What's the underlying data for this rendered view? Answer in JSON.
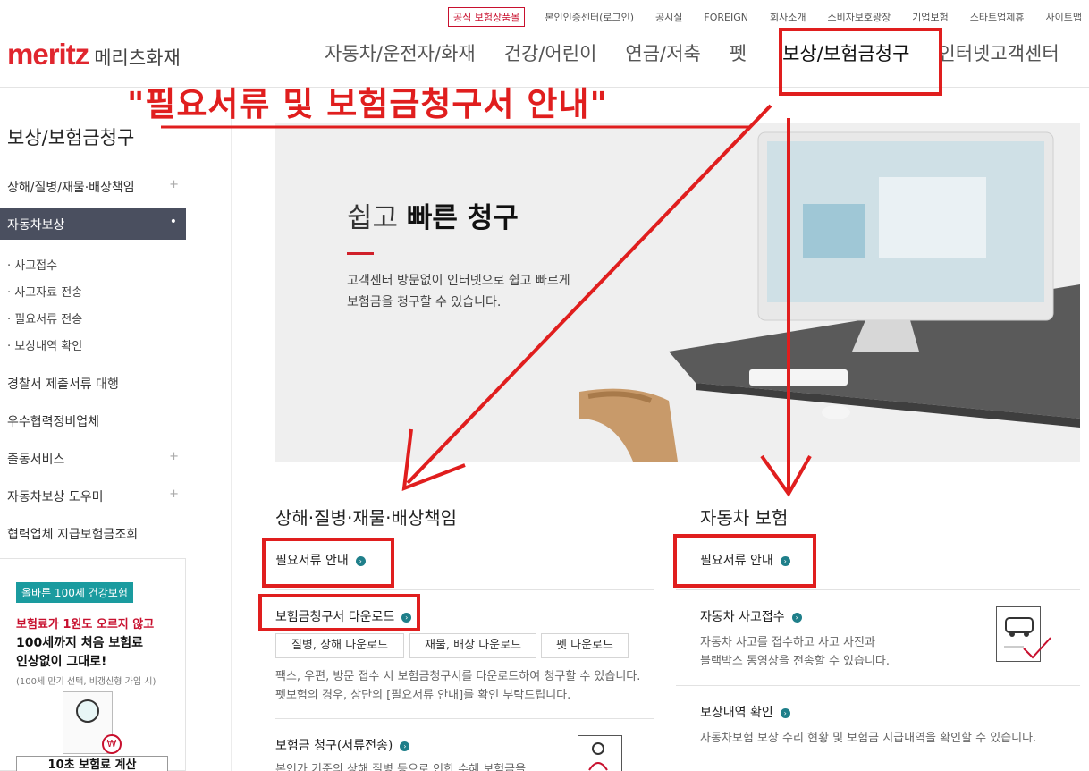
{
  "utility": {
    "official_shop": "공식 보험상품몰",
    "links": [
      "본인인증센터(로그인)",
      "공시실",
      "FOREIGN",
      "회사소개",
      "소비자보호광장",
      "기업보험",
      "스타트업제휴",
      "사이트맵"
    ]
  },
  "brand": {
    "logo_en": "meritz",
    "logo_ko": "메리츠화재",
    "color": "#e0262e"
  },
  "gnb": [
    "자동차/운전자/화재",
    "건강/어린이",
    "연금/저축",
    "펫",
    "보상/보험금청구",
    "인터넷고객센터"
  ],
  "annotation": {
    "title": "\"필요서류 및 보험금청구서 안내\"",
    "color": "#e01e1e"
  },
  "sidebar": {
    "title": "보상/보험금청구",
    "items": [
      {
        "label": "상해/질병/재물·배상책임",
        "plus": "+"
      },
      {
        "label": "자동차보상",
        "plus": "•"
      },
      {
        "label": "경찰서 제출서류 대행",
        "plus": ""
      },
      {
        "label": "우수협력정비업체",
        "plus": ""
      },
      {
        "label": "출동서비스",
        "plus": "+"
      },
      {
        "label": "자동차보상 도우미",
        "plus": "+"
      },
      {
        "label": "협력업체 지급보험금조회",
        "plus": ""
      }
    ],
    "sub_items": [
      "· 사고접수",
      "· 사고자료 전송",
      "· 필요서류 전송",
      "· 보상내역 확인"
    ]
  },
  "ad": {
    "badge": "올바른 100세 건강보험",
    "red_text": "보험료가 1원도 오르지 않고",
    "line1": "100세까지 처음 보험료",
    "line2": "인상없이 그대로!",
    "small": "(100세 만기 선택, 비갱신형 가입 시)",
    "coin": "₩",
    "calc_button": "10초 보험료 계산"
  },
  "hero": {
    "title_light": "쉽고 ",
    "title_bold": "빠른 청구",
    "desc1": "고객센터 방문없이 인터넷으로 쉽고 빠르게",
    "desc2": "보험금을 청구할 수 있습니다."
  },
  "left_section": {
    "title": "상해·질병·재물·배상책임",
    "docs_link": "필요서류 안내",
    "download_link": "보험금청구서 다운로드",
    "downloads": [
      "질병, 상해 다운로드",
      "재물, 배상 다운로드",
      "펫 다운로드"
    ],
    "note1": "팩스, 우편, 방문 접수 시 보험금청구서를 다운로드하여 청구할 수 있습니다.",
    "note2": "펫보험의 경우, 상단의 [필요서류 안내]를 확인 부탁드립니다.",
    "claim_link": "보험금 청구(서류전송)",
    "claim_desc": "본인가 기준의 상해 질병 등으로 인한 수혜 보험금을"
  },
  "right_section": {
    "title": "자동차 보험",
    "docs_link": "필요서류 안내",
    "accident_link": "자동차 사고접수",
    "accident_desc1": "자동차 사고를 접수하고 사고 사진과",
    "accident_desc2": "블랙박스 동영상을 전송할 수 있습니다.",
    "history_link": "보상내역 확인",
    "history_desc": "자동차보험 보상 수리 현황 및 보험금 지급내역을 확인할 수 있습니다."
  }
}
